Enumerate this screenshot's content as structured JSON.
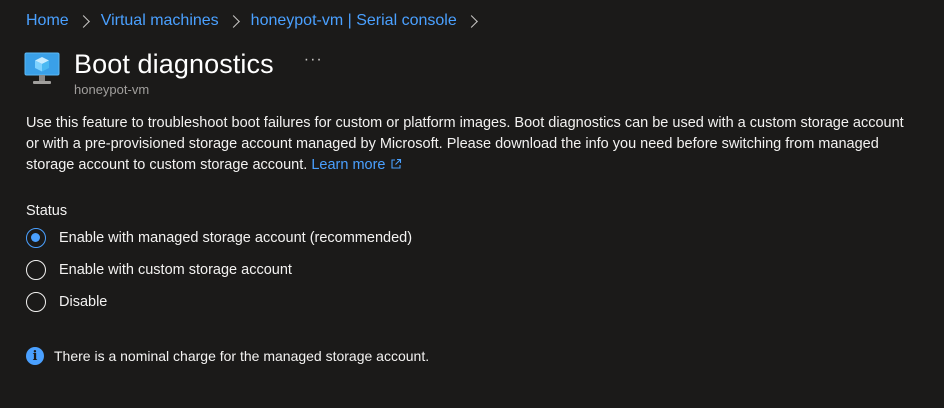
{
  "breadcrumb": {
    "items": [
      "Home",
      "Virtual machines",
      "honeypot-vm | Serial console"
    ]
  },
  "header": {
    "icon": "virtual-machine-icon",
    "title": "Boot diagnostics",
    "more_label": "···",
    "subtitle": "honeypot-vm"
  },
  "description": {
    "text": "Use this feature to troubleshoot boot failures for custom or platform images. Boot diagnostics can be used with a custom storage account or with a pre-provisioned storage account managed by Microsoft. Please download the info you need before switching from managed storage account to custom storage account.",
    "learn_more": "Learn more"
  },
  "status": {
    "label": "Status",
    "options": [
      {
        "label": "Enable with managed storage account (recommended)",
        "selected": true
      },
      {
        "label": "Enable with custom storage account",
        "selected": false
      },
      {
        "label": "Disable",
        "selected": false
      }
    ]
  },
  "info": {
    "icon": "info-icon",
    "text": "There is a nominal charge for the managed storage account."
  },
  "colors": {
    "background": "#1b1a19",
    "accent": "#4aa0ff",
    "text": "#f3f2f1",
    "muted": "#a19f9d"
  }
}
